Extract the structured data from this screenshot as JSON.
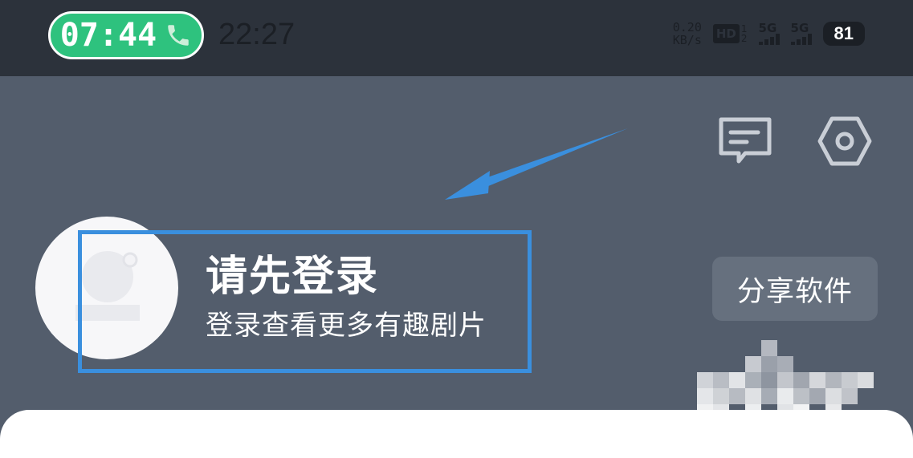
{
  "status_bar": {
    "call_timer": "07:44",
    "clock": "22:27",
    "net_speed_value": "0.20",
    "net_speed_unit": "KB/s",
    "hd_label": "HD",
    "hd_sim_top": "1",
    "hd_sim_bottom": "2",
    "signal_1_label": "5G",
    "signal_2_label": "5G",
    "battery": "81"
  },
  "profile": {
    "login_title": "请先登录",
    "login_subtitle": "登录查看更多有趣剧片"
  },
  "actions": {
    "share_label": "分享软件"
  },
  "colors": {
    "header_bg": "#535d6c",
    "statusbar_bg": "#2c323b",
    "call_green": "#2ec27e",
    "highlight_blue": "#3a8fde",
    "share_bg": "#66707e"
  },
  "icons": {
    "call": "phone-icon",
    "message": "message-icon",
    "settings": "settings-icon",
    "avatar": "avatar-placeholder-icon",
    "annotation": "arrow-annotation"
  }
}
